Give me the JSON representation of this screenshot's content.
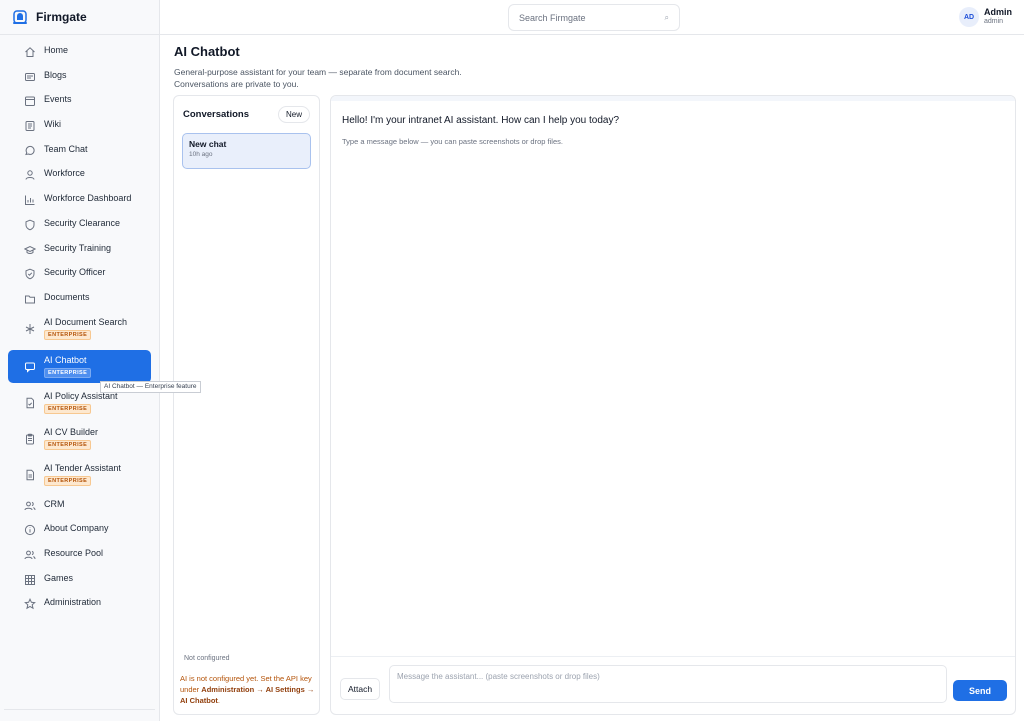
{
  "app": {
    "name": "Firmgate"
  },
  "search": {
    "placeholder": "Search Firmgate"
  },
  "user": {
    "initials": "AD",
    "name": "Admin",
    "role": "admin"
  },
  "sidebar": {
    "items": [
      {
        "label": "Home",
        "icon": "home-icon"
      },
      {
        "label": "Blogs",
        "icon": "blog-icon"
      },
      {
        "label": "Events",
        "icon": "calendar-icon"
      },
      {
        "label": "Wiki",
        "icon": "book-icon"
      },
      {
        "label": "Team Chat",
        "icon": "chat-bubble-icon"
      },
      {
        "label": "Workforce",
        "icon": "user-icon"
      },
      {
        "label": "Workforce Dashboard",
        "icon": "bar-chart-icon"
      },
      {
        "label": "Security Clearance",
        "icon": "shield-icon"
      },
      {
        "label": "Security Training",
        "icon": "graduation-cap-icon"
      },
      {
        "label": "Security Officer",
        "icon": "shield-check-icon"
      },
      {
        "label": "Documents",
        "icon": "folder-icon"
      },
      {
        "label": "AI Document Search",
        "icon": "sparkle-icon",
        "badge": "ENTERPRISE"
      },
      {
        "label": "AI Chatbot",
        "icon": "chat-bubble-icon",
        "badge": "ENTERPRISE",
        "active": true
      },
      {
        "label": "AI Policy Assistant",
        "icon": "document-check-icon",
        "badge": "ENTERPRISE"
      },
      {
        "label": "AI CV Builder",
        "icon": "clipboard-icon",
        "badge": "ENTERPRISE"
      },
      {
        "label": "AI Tender Assistant",
        "icon": "document-icon",
        "badge": "ENTERPRISE"
      },
      {
        "label": "CRM",
        "icon": "users-icon"
      },
      {
        "label": "About Company",
        "icon": "info-icon"
      },
      {
        "label": "Resource Pool",
        "icon": "users-icon"
      },
      {
        "label": "Games",
        "icon": "grid-icon"
      },
      {
        "label": "Administration",
        "icon": "star-icon"
      }
    ],
    "tooltip": "AI Chatbot — Enterprise feature"
  },
  "page": {
    "title": "AI Chatbot",
    "subtitle_line1": "General-purpose assistant for your team — separate from document search.",
    "subtitle_line2": "Conversations are private to you."
  },
  "conversations": {
    "title": "Conversations",
    "new_label": "New",
    "items": [
      {
        "name": "New chat",
        "time": "10h ago"
      }
    ],
    "status": "Not configured",
    "warning_prefix": "AI is not configured yet. Set the API key under ",
    "warning_path": "Administration → AI Settings → AI Chatbot",
    "warning_suffix": "."
  },
  "chat": {
    "greeting": "Hello! I'm your intranet AI assistant. How can I help you today?",
    "hint": "Type a message below — you can paste screenshots or drop files.",
    "attach_label": "Attach",
    "input_placeholder": "Message the assistant... (paste screenshots or drop files)",
    "send_label": "Send"
  },
  "colors": {
    "accent": "#1f6fe5",
    "badge_bg": "#fde8cf",
    "badge_text": "#b45309",
    "warning_text": "#b45309"
  }
}
